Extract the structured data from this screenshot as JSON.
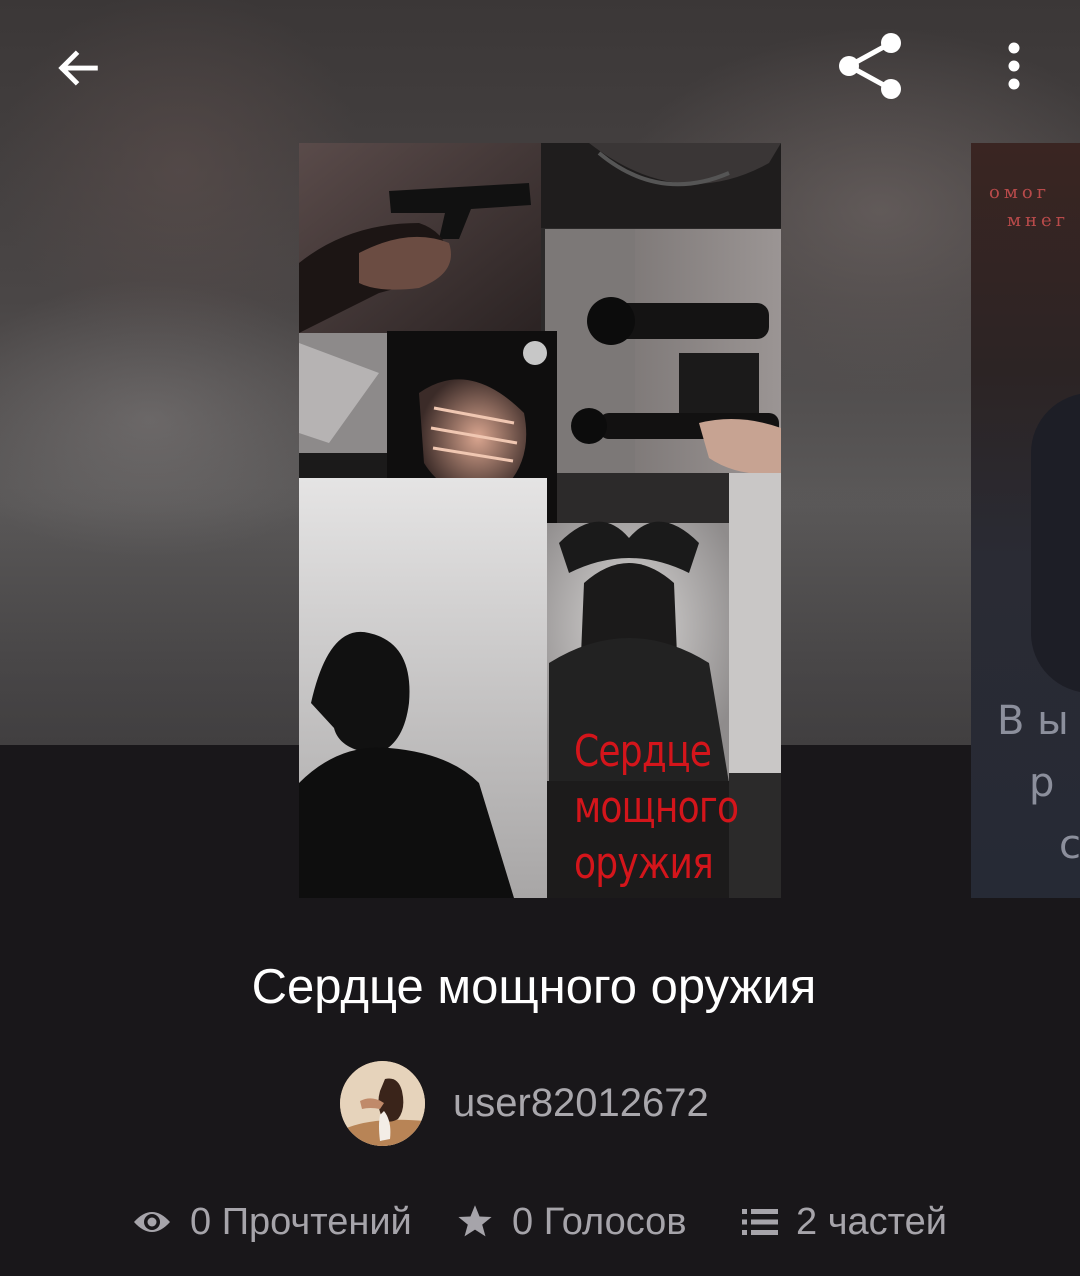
{
  "topbar": {
    "back_icon": "arrow-left-icon",
    "share_icon": "share-icon",
    "more_icon": "more-vertical-icon"
  },
  "cover": {
    "overlay_title_lines": [
      "Сердце",
      "мощного",
      "оружия"
    ],
    "overlay_color": "#d4151b"
  },
  "next_cover": {
    "visible_text_lines": [
      "В ы",
      "р",
      "с"
    ],
    "small_text_lines": [
      "омог",
      "мнег"
    ]
  },
  "story": {
    "title": "Сердце мощного оружия"
  },
  "author": {
    "name": "user82012672"
  },
  "stats": {
    "reads_label": "0 Прочтений",
    "votes_label": "0 Голосов",
    "parts_label": "2 частей",
    "reads_icon": "eye-icon",
    "votes_icon": "star-icon",
    "parts_icon": "list-icon"
  },
  "colors": {
    "background": "#19171a",
    "title_text": "#ffffff",
    "secondary_text": "#a6a4aa"
  }
}
